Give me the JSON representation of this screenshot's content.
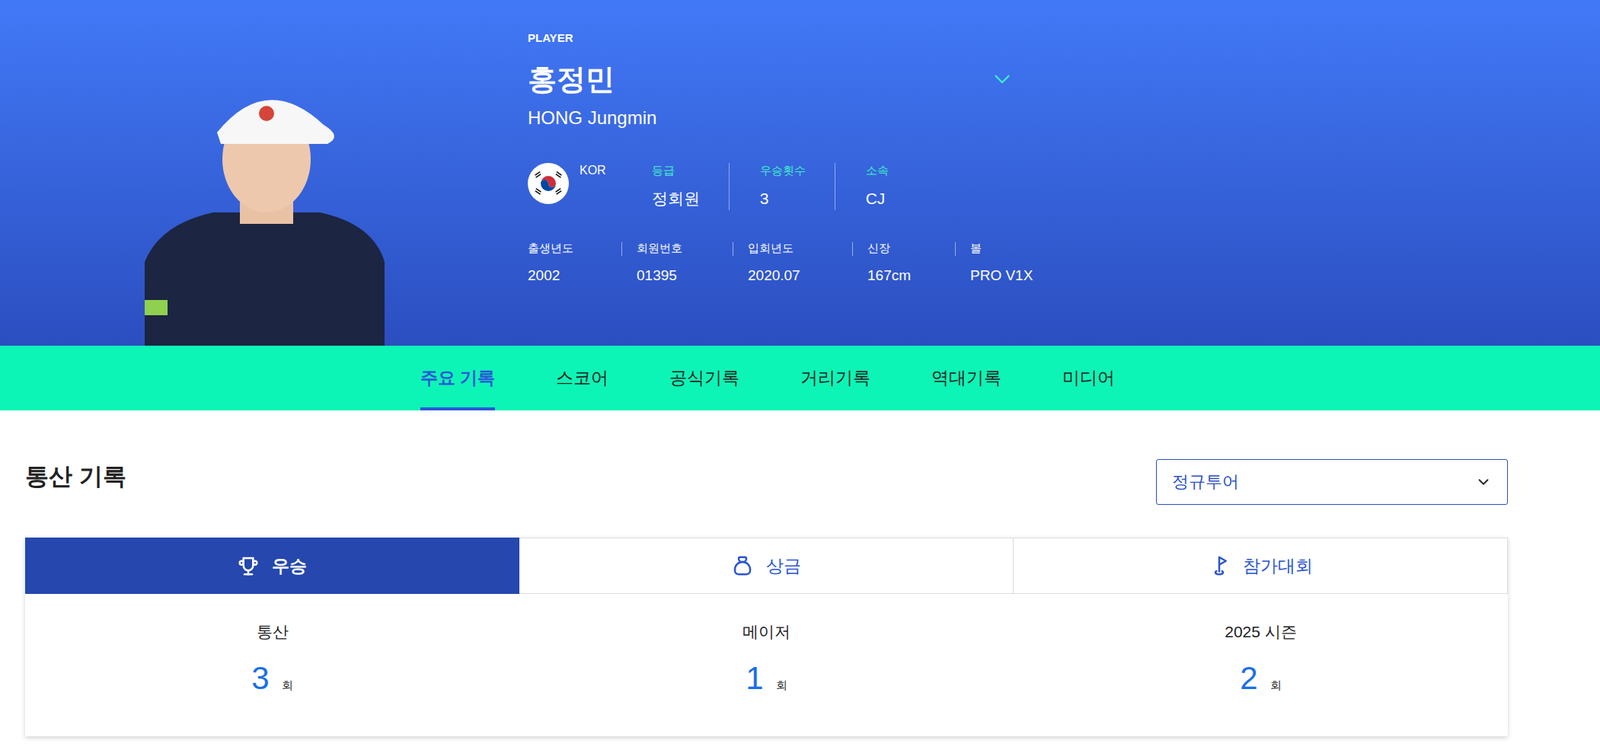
{
  "player": {
    "tag": "PLAYER",
    "name_ko": "홍정민",
    "name_en": "HONG Jungmin",
    "country": "KOR",
    "stats": [
      {
        "label": "등급",
        "value": "정회원"
      },
      {
        "label": "우승횟수",
        "value": "3"
      },
      {
        "label": "소속",
        "value": "CJ"
      }
    ],
    "details": [
      {
        "label": "출생년도",
        "value": "2002"
      },
      {
        "label": "회원번호",
        "value": "01395"
      },
      {
        "label": "입회년도",
        "value": "2020.07"
      },
      {
        "label": "신장",
        "value": "167cm"
      },
      {
        "label": "볼",
        "value": "PRO V1X"
      }
    ]
  },
  "tabs": [
    {
      "label": "주요 기록",
      "selected": true
    },
    {
      "label": "스코어",
      "selected": false
    },
    {
      "label": "공식기록",
      "selected": false
    },
    {
      "label": "거리기록",
      "selected": false
    },
    {
      "label": "역대기록",
      "selected": false
    },
    {
      "label": "미디어",
      "selected": false
    }
  ],
  "section": {
    "title": "통산 기록",
    "dropdown": {
      "value": "정규투어"
    }
  },
  "record_tabs": [
    {
      "label": "우승",
      "selected": true
    },
    {
      "label": "상금",
      "selected": false
    },
    {
      "label": "참가대회",
      "selected": false
    }
  ],
  "record_values": [
    {
      "label": "통산",
      "value": "3",
      "unit": "회"
    },
    {
      "label": "메이저",
      "value": "1",
      "unit": "회"
    },
    {
      "label": "2025 시즌",
      "value": "2",
      "unit": "회"
    }
  ]
}
